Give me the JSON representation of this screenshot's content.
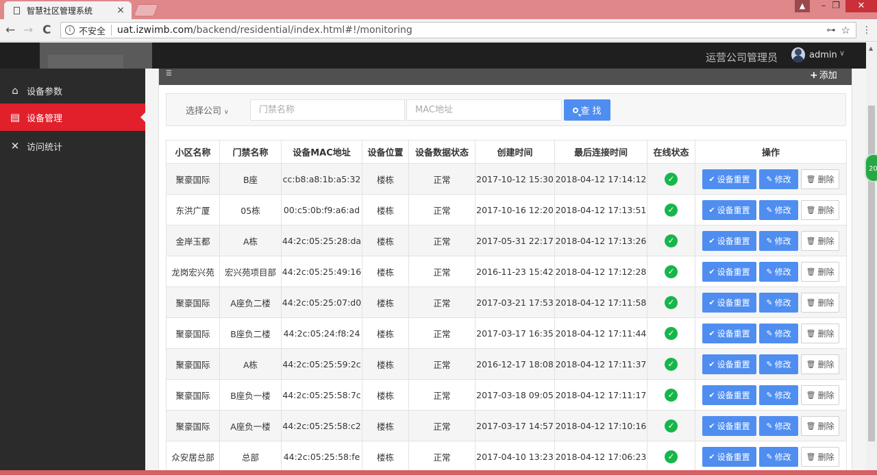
{
  "browser": {
    "tab_title": "智慧社区管理系统",
    "tab_close": "×",
    "nav_back": "←",
    "nav_forward": "→",
    "nav_reload": "C",
    "security_label": "不安全",
    "url_host": "uat.izwimb.com",
    "url_path": "/backend/residential/index.html#!/monitoring",
    "key_icon": "⊶",
    "star_icon": "☆",
    "menu_icon": "⋮",
    "win_minimize": "–",
    "win_restore": "❐",
    "win_close": "✕"
  },
  "header": {
    "role": "运营公司管理员",
    "user": "admin",
    "caret": "∨"
  },
  "sidebar": {
    "items": [
      {
        "label": "设备参数",
        "icon": "home-icon",
        "glyph": "⌂"
      },
      {
        "label": "设备管理",
        "icon": "dashboard-icon",
        "glyph": "▤"
      },
      {
        "label": "访问统计",
        "icon": "close-x-icon",
        "glyph": "✕"
      }
    ]
  },
  "panel": {
    "list_icon": "☰",
    "add_label": "添加",
    "add_glyph": "+"
  },
  "filters": {
    "company_label": "选择公司",
    "company_caret": "∨",
    "gate_placeholder": "门禁名称",
    "mac_placeholder": "MAC地址",
    "search_label": "查 找"
  },
  "table": {
    "headers": [
      "小区名称",
      "门禁名称",
      "设备MAC地址",
      "设备位置",
      "设备数据状态",
      "创建时间",
      "最后连接时间",
      "在线状态",
      "操作"
    ],
    "rows": [
      {
        "community": "聚豪国际",
        "gate": "B座",
        "mac": "cc:b8:a8:1b:a5:32",
        "location": "楼栋",
        "status": "正常",
        "created": "2017-10-12 15:30",
        "last": "2018-04-12 17:14:12"
      },
      {
        "community": "东洪广厦",
        "gate": "05栋",
        "mac": "00:c5:0b:f9:a6:ad",
        "location": "楼栋",
        "status": "正常",
        "created": "2017-10-16 12:20",
        "last": "2018-04-12 17:13:51"
      },
      {
        "community": "金岸玉都",
        "gate": "A栋",
        "mac": "44:2c:05:25:28:da",
        "location": "楼栋",
        "status": "正常",
        "created": "2017-05-31 22:17",
        "last": "2018-04-12 17:13:26"
      },
      {
        "community": "龙岗宏兴苑",
        "gate": "宏兴苑项目部",
        "mac": "44:2c:05:25:49:16",
        "location": "楼栋",
        "status": "正常",
        "created": "2016-11-23 15:42",
        "last": "2018-04-12 17:12:28"
      },
      {
        "community": "聚豪国际",
        "gate": "A座负二楼",
        "mac": "44:2c:05:25:07:d0",
        "location": "楼栋",
        "status": "正常",
        "created": "2017-03-21 17:53",
        "last": "2018-04-12 17:11:58"
      },
      {
        "community": "聚豪国际",
        "gate": "B座负二楼",
        "mac": "44:2c:05:24:f8:24",
        "location": "楼栋",
        "status": "正常",
        "created": "2017-03-17 16:35",
        "last": "2018-04-12 17:11:44"
      },
      {
        "community": "聚豪国际",
        "gate": "A栋",
        "mac": "44:2c:05:25:59:2c",
        "location": "楼栋",
        "status": "正常",
        "created": "2016-12-17 18:08",
        "last": "2018-04-12 17:11:37"
      },
      {
        "community": "聚豪国际",
        "gate": "B座负一楼",
        "mac": "44:2c:05:25:58:7c",
        "location": "楼栋",
        "status": "正常",
        "created": "2017-03-18 09:05",
        "last": "2018-04-12 17:11:17"
      },
      {
        "community": "聚豪国际",
        "gate": "A座负一楼",
        "mac": "44:2c:05:25:58:c2",
        "location": "楼栋",
        "status": "正常",
        "created": "2017-03-17 14:57",
        "last": "2018-04-12 17:10:16"
      },
      {
        "community": "众安居总部",
        "gate": "总部",
        "mac": "44:2c:05:25:58:fe",
        "location": "楼栋",
        "status": "正常",
        "created": "2017-04-10 13:23",
        "last": "2018-04-12 17:06:23"
      }
    ],
    "online_glyph": "✓",
    "actions": {
      "reset_label": "设备重置",
      "reset_glyph": "✔",
      "edit_label": "修改",
      "edit_glyph": "✎",
      "delete_label": "删除",
      "delete_glyph": "🗑"
    }
  },
  "floating_badge": "20",
  "colors": {
    "accent_blue": "#4f8ef0",
    "active_red": "#e2202b",
    "online_green": "#17b64a",
    "sidebar_bg": "#2b2b2b"
  }
}
